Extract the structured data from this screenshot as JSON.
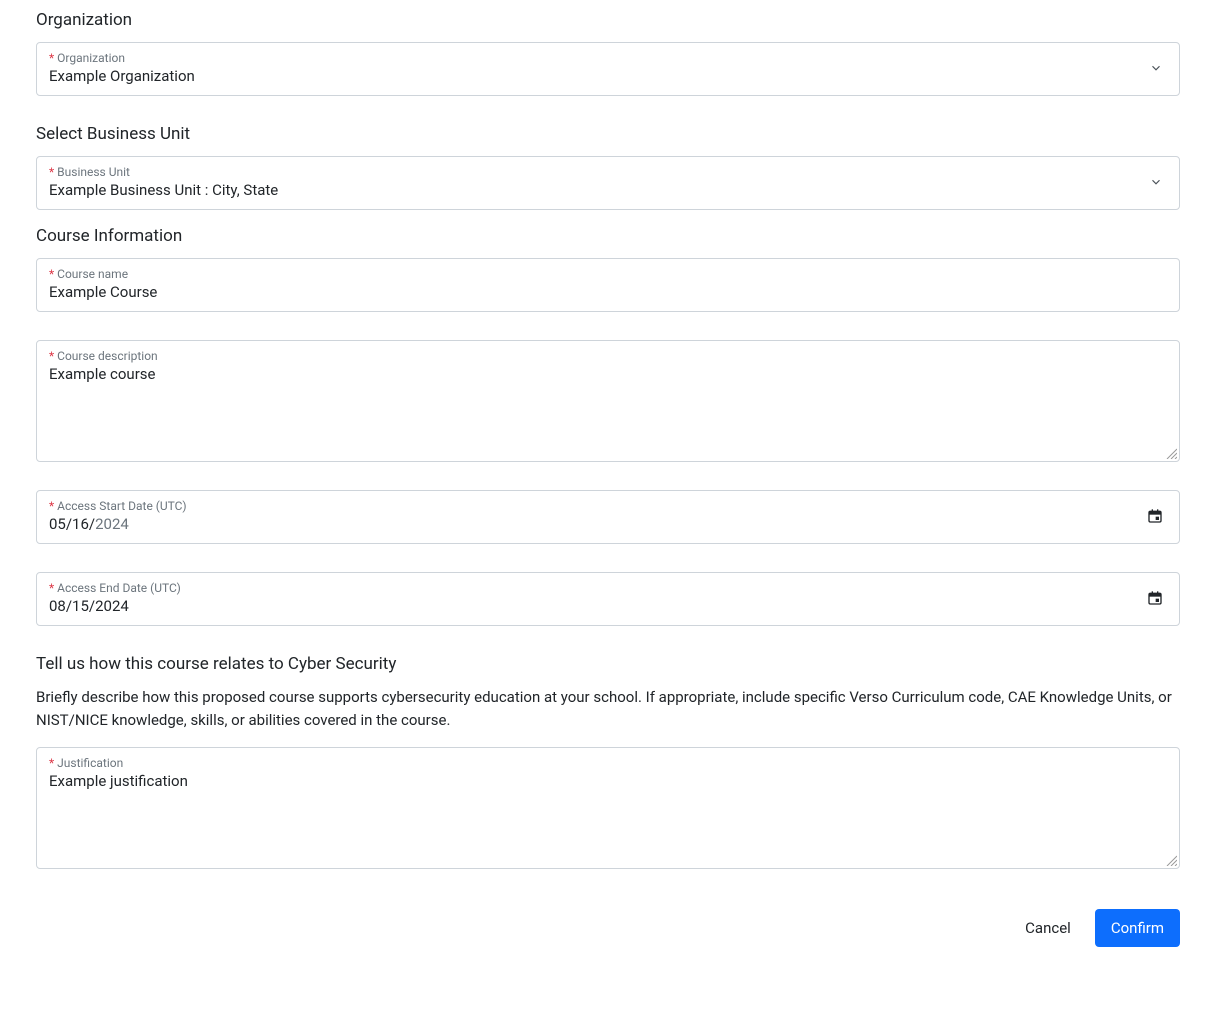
{
  "sections": {
    "organization": {
      "title": "Organization",
      "label": "Organization",
      "value": "Example Organization"
    },
    "businessUnit": {
      "title": "Select Business Unit",
      "label": "Business Unit",
      "value": "Example Business Unit : City, State"
    },
    "courseInfo": {
      "title": "Course Information",
      "courseName": {
        "label": "Course name",
        "value": "Example Course"
      },
      "courseDescription": {
        "label": "Course description",
        "value": "Example course"
      },
      "accessStart": {
        "label": "Access Start Date (UTC)",
        "value": "05/16/2024",
        "visiblePart": "05/16/",
        "grayPart": "2024"
      },
      "accessEnd": {
        "label": "Access End Date (UTC)",
        "value": "08/15/2024"
      }
    },
    "cyber": {
      "title": "Tell us how this course relates to Cyber Security",
      "helper": "Briefly describe how this proposed course supports cybersecurity education at your school. If appropriate, include specific Verso Curriculum code, CAE Knowledge Units, or NIST/NICE knowledge, skills, or abilities covered in the course.",
      "justification": {
        "label": "Justification",
        "value": "Example justification"
      }
    }
  },
  "buttons": {
    "cancel": "Cancel",
    "confirm": "Confirm"
  },
  "requiredMark": "*"
}
